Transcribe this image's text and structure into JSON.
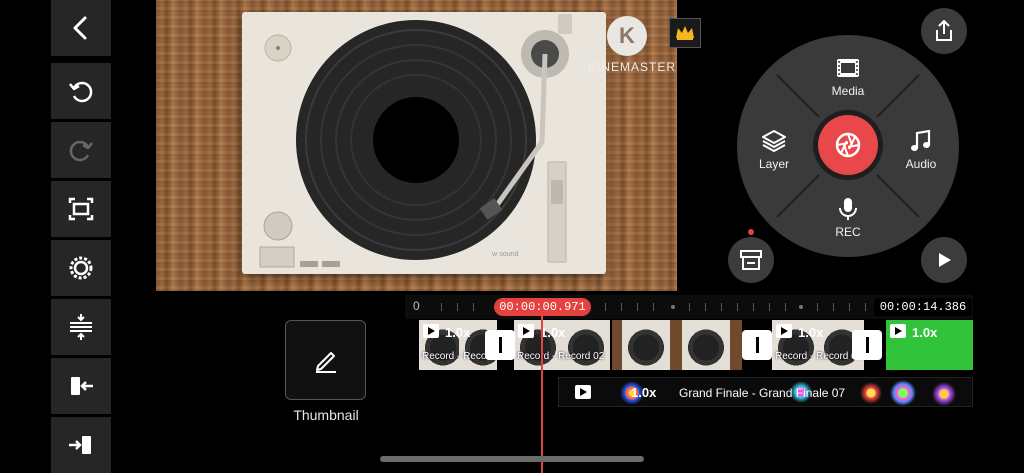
{
  "toolbar": {
    "items": [
      {
        "name": "back-icon"
      },
      {
        "name": "undo-icon"
      },
      {
        "name": "redo-icon"
      },
      {
        "name": "screen-capture-icon"
      },
      {
        "name": "settings-icon"
      },
      {
        "name": "split-icon"
      },
      {
        "name": "clip-in-icon"
      },
      {
        "name": "clip-out-icon"
      }
    ]
  },
  "preview": {
    "watermark_logo": "K",
    "watermark_text": "KINEMASTER"
  },
  "radial_menu": {
    "media_label": "Media",
    "layer_label": "Layer",
    "audio_label": "Audio",
    "rec_label": "REC",
    "accent_color": "#e9484a"
  },
  "thumbnail": {
    "label": "Thumbnail"
  },
  "timeline": {
    "ruler_start": "0",
    "current_time": "00:00:00.971",
    "total_time": "00:00:14.386",
    "clips": [
      {
        "speed": "1.0x",
        "name": "Record - Record 01"
      },
      {
        "speed": "1.0x",
        "name": "Record - Record 02"
      },
      {
        "speed": "",
        "name": ""
      },
      {
        "speed": "1.0x",
        "name": "Record - Record 03"
      },
      {
        "speed": "1.0x",
        "name": ""
      }
    ],
    "audio": {
      "speed": "1.0x",
      "name": "Grand Finale - Grand Finale 07"
    }
  }
}
